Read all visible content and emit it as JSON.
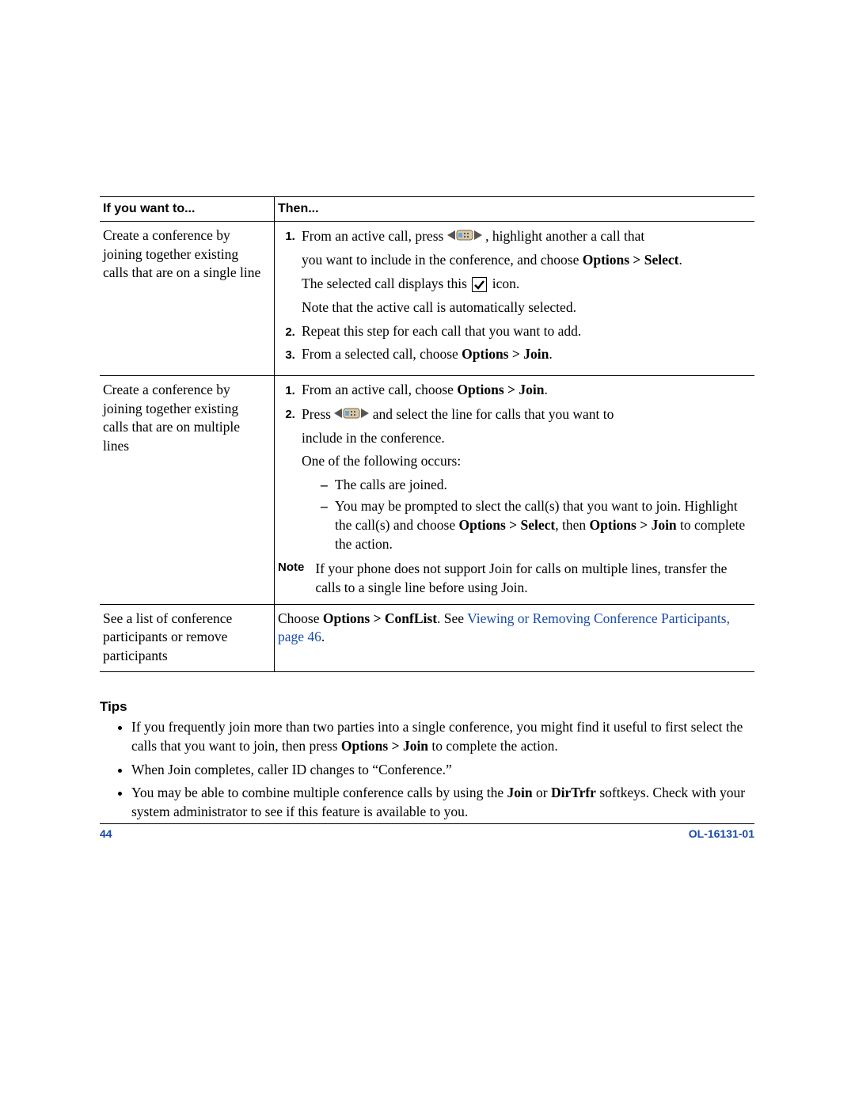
{
  "table": {
    "headers": {
      "col1": "If you want to...",
      "col2": "Then..."
    },
    "rows": [
      {
        "want": "Create a conference by joining together existing calls that are on a single line",
        "steps": [
          {
            "pre": "From an active call, press ",
            "mid": ", highlight another a call that",
            "p1a": "you want to include in the conference, and choose ",
            "p1b_bold": "Options > Select",
            "p1c": ".",
            "p2a": "The selected call displays this ",
            "p2b": " icon.",
            "p3": "Note that the active call is automatically selected."
          },
          {
            "text": "Repeat this step for each call that you want to add."
          },
          {
            "pre": "From a selected call, choose ",
            "bold": "Options > Join",
            "post": "."
          }
        ]
      },
      {
        "want": "Create a conference by joining together existing calls that are on multiple lines",
        "steps": [
          {
            "pre": "From an active call, choose ",
            "bold": "Options > Join",
            "post": "."
          },
          {
            "pre": "Press ",
            "mid": " and select the line for calls that you want to",
            "p1": "include in the conference.",
            "p2": "One of the following occurs:",
            "bullets": [
              {
                "text": "The calls are joined."
              },
              {
                "a": "You may be prompted to slect the call(s) that you want to join. Highlight the call(s) and choose ",
                "b1": "Options > Select",
                "mid": ", then ",
                "b2": "Options > Join",
                "post": " to complete the action."
              }
            ]
          }
        ],
        "note": {
          "label": "Note",
          "body": "If your phone does not support Join for calls on multiple lines, transfer the calls to a single line before using Join."
        }
      },
      {
        "want": "See a list of conference participants or remove participants",
        "plain": {
          "a": "Choose ",
          "b": "Options > ConfList",
          "c": ". See ",
          "link": "Viewing or Removing Conference Participants, page 46",
          "d": "."
        }
      }
    ]
  },
  "tips": {
    "heading": "Tips",
    "items": [
      {
        "a": "If you frequently join more than two parties into a single conference, you might find it useful to first select the calls that you want to join, then press ",
        "b": "Options > Join",
        "c": " to complete the action."
      },
      {
        "text": "When Join completes, caller ID changes to “Conference.”"
      },
      {
        "a": "You may be able to combine multiple conference calls by using the ",
        "b1": "Join",
        "mid": " or ",
        "b2": "DirTrfr",
        "c": " softkeys. Check with your system administrator to see if this feature is available to you."
      }
    ]
  },
  "footer": {
    "page": "44",
    "docid": "OL-16131-01"
  }
}
